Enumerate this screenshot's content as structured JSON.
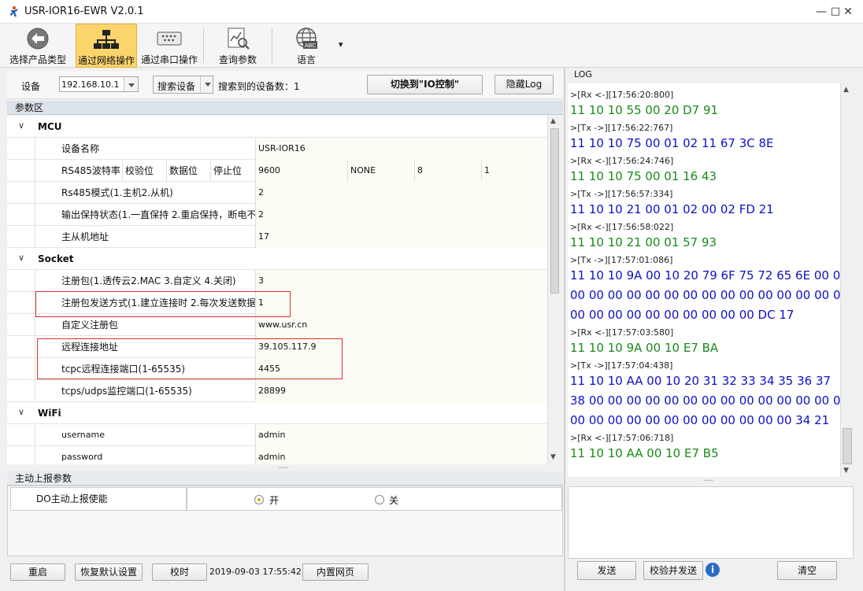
{
  "window": {
    "title": "USR-IOR16-EWR V2.0.1",
    "controls": [
      "—",
      "□",
      "✕"
    ]
  },
  "toolbar": {
    "items": [
      {
        "label": "选择产品类型",
        "icon": "back-arrow-icon"
      },
      {
        "label": "通过网络操作",
        "icon": "network-icon"
      },
      {
        "label": "通过串口操作",
        "icon": "serial-port-icon"
      },
      {
        "label": "查询参数",
        "icon": "query-chart-icon"
      },
      {
        "label": "语言",
        "icon": "globe-abc-icon"
      }
    ],
    "dropdown_glyph": "▾"
  },
  "device_bar": {
    "device_label": "设备",
    "ip_value": "192.168.10.1",
    "search_label": "搜索设备",
    "found_label": "搜索到的设备数：",
    "found_count": "1",
    "switch_label": "切换到\"IO控制\"",
    "hide_log_label": "隐藏Log"
  },
  "params": {
    "section_title": "参数区",
    "groups": [
      {
        "name": "MCU",
        "rows": [
          {
            "name": "设备名称",
            "value": "USR-IOR16"
          },
          {
            "sub": [
              "RS485波特率",
              "校验位",
              "数据位",
              "停止位"
            ],
            "values": [
              "9600",
              "NONE",
              "8",
              "1"
            ]
          },
          {
            "name": "Rs485模式(1.主机2.从机)",
            "value": "2"
          },
          {
            "name": "输出保持状态(1.一直保持 2.重启保持，断电不",
            "value": "2"
          },
          {
            "name": "主从机地址",
            "value": "17"
          }
        ]
      },
      {
        "name": "Socket",
        "rows": [
          {
            "name": "注册包(1.透传云2.MAC 3.自定义 4.关闭)",
            "value": "3"
          },
          {
            "name": "注册包发送方式(1.建立连接时 2.每次发送数据",
            "value": "1"
          },
          {
            "name": "自定义注册包",
            "value": "www.usr.cn"
          },
          {
            "name": "远程连接地址",
            "value": "39.105.117.9"
          },
          {
            "name": "tcpc远程连接端口(1-65535)",
            "value": "4455"
          },
          {
            "name": "tcps/udps监控端口(1-65535)",
            "value": "28899"
          }
        ]
      },
      {
        "name": "WiFi",
        "rows": [
          {
            "name": "username",
            "value": "admin"
          },
          {
            "name": "password",
            "value": "admin"
          }
        ]
      }
    ],
    "splitter": "····"
  },
  "report": {
    "section_title": "主动上报参数",
    "row_label": "DO主动上报使能",
    "option_on": "开",
    "option_off": "关"
  },
  "bottom_bar": {
    "restart": "重启",
    "restore": "恢复默认设置",
    "time_sync": "校时",
    "datetime": "2019-09-03 17:55:42 2",
    "web": "内置网页"
  },
  "log": {
    "title": "LOG",
    "lines": [
      {
        "t": "hd",
        "text": ">[Rx <-][17:56:20:800]"
      },
      {
        "t": "rx",
        "text": "11 10 10 55 00 20 D7 91"
      },
      {
        "t": "hd",
        "text": ">[Tx ->][17:56:22:767]"
      },
      {
        "t": "tx",
        "text": "11 10 10 75 00 01 02 11 67 3C 8E"
      },
      {
        "t": "hd",
        "text": ">[Rx <-][17:56:24:746]"
      },
      {
        "t": "rx",
        "text": "11 10 10 75 00 01 16 43"
      },
      {
        "t": "hd",
        "text": ">[Tx ->][17:56:57:334]"
      },
      {
        "t": "tx",
        "text": "11 10 10 21 00 01 02 00 02 FD 21"
      },
      {
        "t": "hd",
        "text": ">[Rx <-][17:56:58:022]"
      },
      {
        "t": "rx",
        "text": "11 10 10 21 00 01 57 93"
      },
      {
        "t": "hd",
        "text": ">[Tx ->][17:57:01:086]"
      },
      {
        "t": "tx",
        "text": "11 10 10 9A 00 10 20 79 6F 75 72 65 6E 00 00"
      },
      {
        "t": "tx",
        "text": "00 00 00 00 00 00 00 00 00 00 00 00 00 00 00"
      },
      {
        "t": "tx",
        "text": "00 00 00 00 00 00 00 00 00 00 DC 17"
      },
      {
        "t": "hd",
        "text": ">[Rx <-][17:57:03:580]"
      },
      {
        "t": "rx",
        "text": "11 10 10 9A 00 10 E7 BA"
      },
      {
        "t": "hd",
        "text": ">[Tx ->][17:57:04:438]"
      },
      {
        "t": "tx",
        "text": "11 10 10 AA 00 10 20 31 32 33 34 35 36 37"
      },
      {
        "t": "tx",
        "text": "38 00 00 00 00 00 00 00 00 00 00 00 00 00 00"
      },
      {
        "t": "tx",
        "text": "00 00 00 00 00 00 00 00 00 00 00 00 34 21"
      },
      {
        "t": "hd",
        "text": ">[Rx <-][17:57:06:718]"
      },
      {
        "t": "rx",
        "text": "11 10 10 AA 00 10 E7 B5"
      }
    ],
    "splitter": "····",
    "send_label": "发送",
    "verify_send_label": "校验并发送",
    "info_glyph": "i",
    "clear_label": "清空"
  },
  "colors": {
    "accent_active": "#fbd46c",
    "rx": "#1a8a1a",
    "tx": "#1010c8",
    "highlight_border": "#d9302c"
  }
}
